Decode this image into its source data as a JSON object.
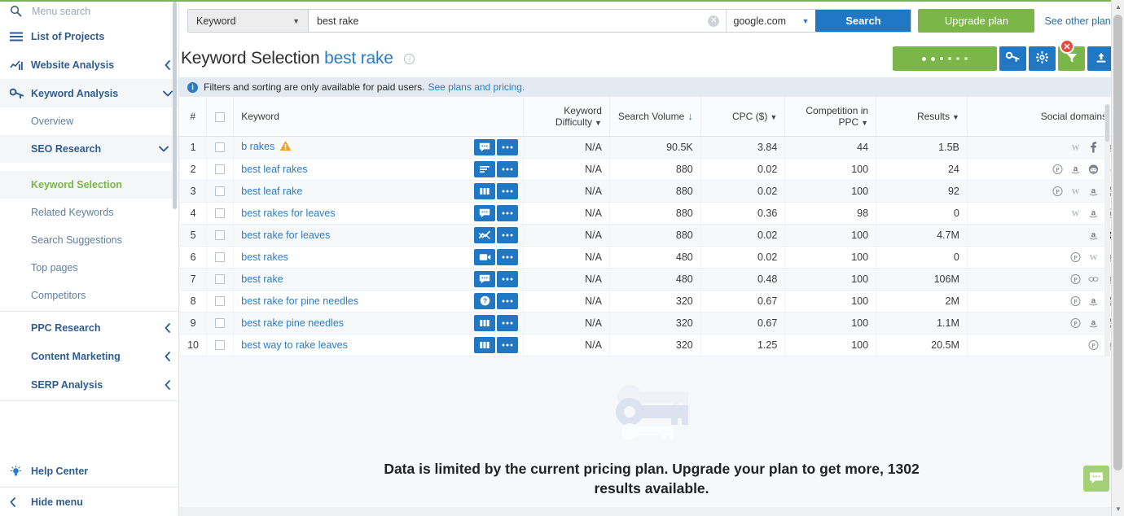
{
  "sidebar": {
    "search_placeholder": "Menu search",
    "projects_label": "List of Projects",
    "nav": [
      {
        "label": "Website Analysis",
        "icon": "bar-chart-icon",
        "chevron": "chevron-left"
      },
      {
        "label": "Keyword Analysis",
        "icon": "key-icon",
        "chevron": "chevron-down"
      }
    ],
    "keyword_sub": [
      {
        "label": "Overview"
      },
      {
        "label": "SEO Research",
        "chevron": "chevron-down"
      }
    ],
    "seo_items": [
      {
        "label": "Keyword Selection",
        "selected": true
      },
      {
        "label": "Related Keywords",
        "selected": false
      },
      {
        "label": "Search Suggestions",
        "selected": false
      },
      {
        "label": "Top pages",
        "selected": false
      },
      {
        "label": "Competitors",
        "selected": false
      }
    ],
    "bottom_nav": [
      {
        "label": "PPC Research",
        "chevron": "chevron-left"
      },
      {
        "label": "Content Marketing",
        "chevron": "chevron-left"
      },
      {
        "label": "SERP Analysis",
        "chevron": "chevron-left"
      }
    ],
    "help_label": "Help Center",
    "hide_label": "Hide menu"
  },
  "toolbar": {
    "type_select": "Keyword",
    "query_value": "best rake",
    "query_placeholder": "",
    "engine_select": "google.com",
    "search_button": "Search",
    "upgrade_button": "Upgrade plan",
    "see_other_plans": "See other plans"
  },
  "header": {
    "title": "Keyword Selection",
    "keyword": "best rake",
    "info_tooltip": "i",
    "buttons": {
      "key_button": "key-icon",
      "settings_button": "gear-icon",
      "filter_button": "funnel-icon",
      "export_button": "upload-icon",
      "close_badge": "✕"
    }
  },
  "info_bar": {
    "text": "Filters and sorting are only available for paid users.",
    "link": "See plans and pricing."
  },
  "table": {
    "columns": [
      {
        "key": "index",
        "label": "#",
        "align": "center"
      },
      {
        "key": "check",
        "label": "",
        "align": "center"
      },
      {
        "key": "keyword",
        "label": "Keyword",
        "align": "left"
      },
      {
        "key": "kd",
        "label": "Keyword Difficulty",
        "align": "right",
        "caret": true
      },
      {
        "key": "volume",
        "label": "Search Volume",
        "align": "right",
        "sorted": "desc"
      },
      {
        "key": "cpc",
        "label": "CPC ($)",
        "align": "right",
        "caret": true
      },
      {
        "key": "comp",
        "label": "Competition in PPC",
        "align": "right",
        "caret": true
      },
      {
        "key": "results",
        "label": "Results",
        "align": "right",
        "caret": true
      },
      {
        "key": "social",
        "label": "Social domains",
        "align": "right",
        "caret": true
      }
    ],
    "rows": [
      {
        "index": "1",
        "keyword": "b rakes",
        "warn": true,
        "action_icon": "comment-icon",
        "kd": "N/A",
        "volume": "90.5K",
        "cpc": "3.84",
        "comp": "44",
        "results": "1.5B",
        "social": [
          "W",
          "f",
          "a"
        ]
      },
      {
        "index": "2",
        "keyword": "best leaf rakes",
        "warn": false,
        "action_icon": "lines-icon",
        "kd": "N/A",
        "volume": "880",
        "cpc": "0.02",
        "comp": "100",
        "results": "24",
        "social": [
          "P",
          "a",
          "R",
          "W"
        ]
      },
      {
        "index": "3",
        "keyword": "best leaf rake",
        "warn": false,
        "action_icon": "columns-icon",
        "kd": "N/A",
        "volume": "880",
        "cpc": "0.02",
        "comp": "100",
        "results": "92",
        "social": [
          "P",
          "W",
          "a",
          "R"
        ]
      },
      {
        "index": "4",
        "keyword": "best rakes for leaves",
        "warn": false,
        "action_icon": "comment-icon",
        "kd": "N/A",
        "volume": "880",
        "cpc": "0.36",
        "comp": "98",
        "results": "0",
        "social": [
          "W",
          "a",
          "P"
        ]
      },
      {
        "index": "5",
        "keyword": "best rake for leaves",
        "warn": false,
        "action_icon": "trend-icon",
        "kd": "N/A",
        "volume": "880",
        "cpc": "0.02",
        "comp": "100",
        "results": "4.7M",
        "social": [
          "a",
          "Y"
        ]
      },
      {
        "index": "6",
        "keyword": "best rakes",
        "warn": false,
        "action_icon": "video-icon",
        "kd": "N/A",
        "volume": "480",
        "cpc": "0.02",
        "comp": "100",
        "results": "0",
        "social": [
          "P",
          "W",
          "a"
        ]
      },
      {
        "index": "7",
        "keyword": "best rake",
        "warn": false,
        "action_icon": "comment-icon",
        "kd": "N/A",
        "volume": "480",
        "cpc": "0.48",
        "comp": "100",
        "results": "106M",
        "social": [
          "P",
          "E",
          "a"
        ]
      },
      {
        "index": "8",
        "keyword": "best rake for pine needles",
        "warn": false,
        "action_icon": "question-icon",
        "kd": "N/A",
        "volume": "320",
        "cpc": "0.67",
        "comp": "100",
        "results": "2M",
        "social": [
          "P",
          "a",
          "R"
        ]
      },
      {
        "index": "9",
        "keyword": "best rake pine needles",
        "warn": false,
        "action_icon": "columns-icon",
        "kd": "N/A",
        "volume": "320",
        "cpc": "0.67",
        "comp": "100",
        "results": "1.1M",
        "social": [
          "P",
          "a",
          "R"
        ]
      },
      {
        "index": "10",
        "keyword": "best way to rake leaves",
        "warn": false,
        "action_icon": "columns-icon",
        "kd": "N/A",
        "volume": "320",
        "cpc": "1.25",
        "comp": "100",
        "results": "20.5M",
        "social": [
          "P",
          "a"
        ]
      }
    ],
    "row_more_icon": "ellipsis-icon"
  },
  "upsell": {
    "message": "Data is limited by the current pricing plan. Upgrade your plan to get more, 1302 results available.",
    "art": "key-illustration"
  },
  "chat": {
    "icon": "chat-bubble-icon"
  },
  "colors": {
    "accent_green": "#7ab648",
    "accent_blue": "#2077c4",
    "link_blue": "#2b7cc4",
    "warn_orange": "#f0a32a",
    "close_red": "#e8493a"
  }
}
